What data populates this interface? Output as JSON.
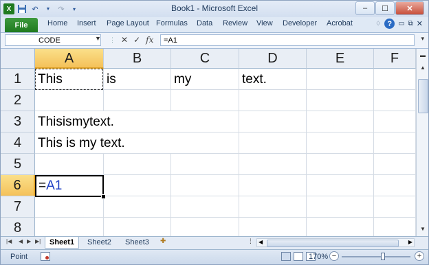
{
  "window": {
    "title": "Book1 - Microsoft Excel",
    "controls": {
      "minimize": "–",
      "maximize": "☐",
      "close": "✕"
    }
  },
  "quick_access": {
    "icons": [
      "excel-logo-icon",
      "save-icon",
      "undo-icon",
      "redo-icon",
      "customize-icon"
    ]
  },
  "ribbon": {
    "file_label": "File",
    "tabs": [
      "Home",
      "Insert",
      "Page Layout",
      "Formulas",
      "Data",
      "Review",
      "View",
      "Developer",
      "Acrobat"
    ],
    "help_label": "?"
  },
  "formula_bar": {
    "name_box": "CODE",
    "formula": "=A1",
    "fx_label": "fx"
  },
  "grid": {
    "columns": [
      "A",
      "B",
      "C",
      "D",
      "E",
      "F"
    ],
    "rows": [
      "1",
      "2",
      "3",
      "4",
      "5",
      "6",
      "7",
      "8"
    ],
    "cells": {
      "A1": "This",
      "B1": "is",
      "C1": "my",
      "D1": "text.",
      "A3": "Thisismytext.",
      "A4": "This is my text.",
      "A6_prefix": "=",
      "A6_ref": "A1"
    },
    "selected_column": "A",
    "selected_row": "6",
    "active_cell": "A6",
    "copy_cell": "A1"
  },
  "sheets": {
    "tabs": [
      "Sheet1",
      "Sheet2",
      "Sheet3"
    ],
    "active": "Sheet1"
  },
  "status_bar": {
    "mode": "Point",
    "zoom": "170%",
    "zoom_level_fraction": 0.6
  },
  "colors": {
    "accent": "#1f7a1f",
    "header_selected": "#f4c15a",
    "reference_blue": "#1f3fc4"
  }
}
